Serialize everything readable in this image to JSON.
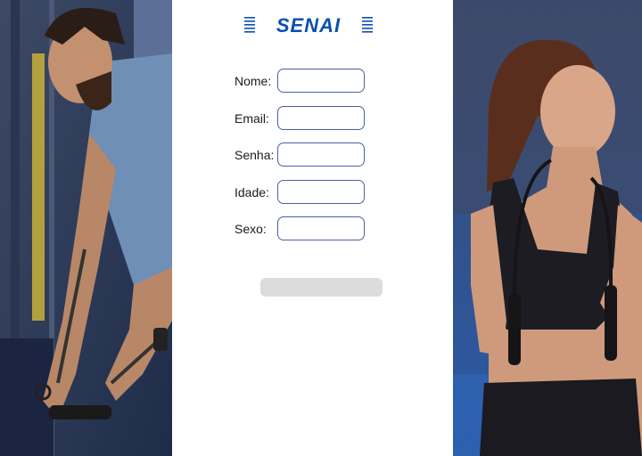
{
  "brand": {
    "logo_text": "SENAI",
    "color": "#0a4fb0"
  },
  "form": {
    "fields": [
      {
        "label": "Nome:",
        "value": "",
        "placeholder": ""
      },
      {
        "label": "Email:",
        "value": "",
        "placeholder": ""
      },
      {
        "label": "Senha:",
        "value": "",
        "placeholder": ""
      },
      {
        "label": "Idade:",
        "value": "",
        "placeholder": ""
      },
      {
        "label": "Sexo:",
        "value": "",
        "placeholder": ""
      }
    ],
    "submit_label": ""
  },
  "photos": {
    "left": "man-training-cable-machine",
    "right": "woman-with-jump-rope"
  },
  "colors": {
    "photo_tint": "#2f5aa0",
    "field_border": "#4a5fa8",
    "button_bg": "#dcdcdc"
  }
}
